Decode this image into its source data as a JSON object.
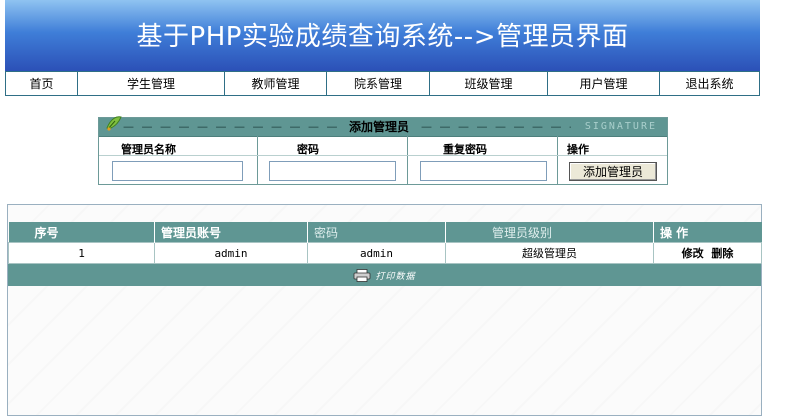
{
  "header": {
    "title": "基于PHP实验成绩查询系统-->管理员界面"
  },
  "nav": [
    {
      "label": "首页"
    },
    {
      "label": "学生管理"
    },
    {
      "label": "教师管理"
    },
    {
      "label": "院系管理"
    },
    {
      "label": "班级管理"
    },
    {
      "label": "用户管理"
    },
    {
      "label": "退出系统"
    }
  ],
  "add_form": {
    "title": "添加管理员",
    "watermark": "SIGNATURE",
    "columns": [
      "管理员名称",
      "密码",
      "重复密码",
      "操作"
    ],
    "inputs": {
      "name": "",
      "password": "",
      "repeat_password": ""
    },
    "submit_label": "添加管理员"
  },
  "admin_table": {
    "headers": [
      "序号",
      "管理员账号",
      "密码",
      "管理员级别",
      "操 作"
    ],
    "rows": [
      {
        "index": "1",
        "account": "admin",
        "password": "admin",
        "level": "超级管理员",
        "edit": "修改",
        "delete": "删除"
      }
    ],
    "print_label": "打印数据"
  },
  "colors": {
    "banner": "#2b4fb6",
    "teal_header": "#5f9693"
  }
}
